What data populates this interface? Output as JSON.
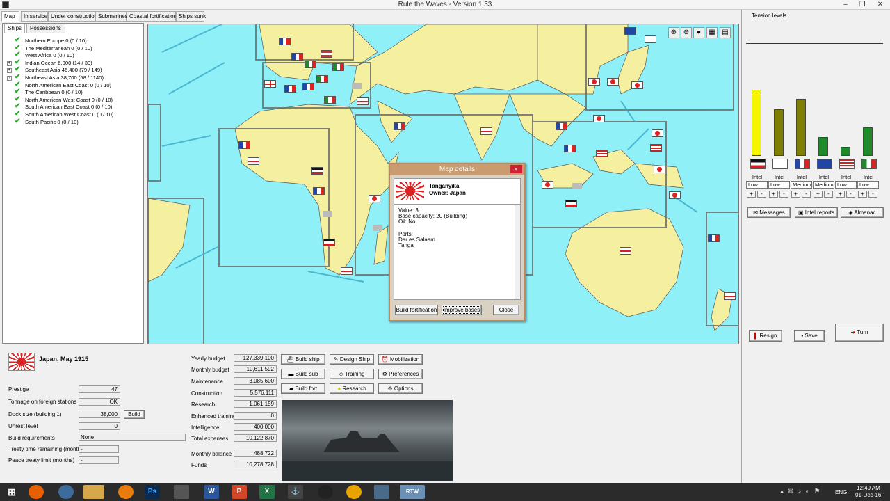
{
  "window": {
    "title": "Rule the Waves - Version 1.33",
    "minimize": "–",
    "restore": "❐",
    "close": "✕"
  },
  "tabs": [
    "Map",
    "In service",
    "Under construction",
    "Submarines",
    "Coastal fortifications",
    "Ships sunk"
  ],
  "subtabs": [
    "Ships",
    "Possessions"
  ],
  "regions": [
    {
      "label": "Northern Europe 0 (0 / 10)",
      "expandable": false
    },
    {
      "label": "The Mediterranean 0 (0 / 10)",
      "expandable": false
    },
    {
      "label": "West Africa 0 (0 / 10)",
      "expandable": false
    },
    {
      "label": "Indian Ocean 6,000 (14 / 30)",
      "expandable": true
    },
    {
      "label": "Southeast Asia 46,400 (79 / 149)",
      "expandable": true
    },
    {
      "label": "Northeast Asia 38,700 (58 / 1140)",
      "expandable": true
    },
    {
      "label": "North American East Coast 0 (0 / 10)",
      "expandable": false
    },
    {
      "label": "The Caribbean 0 (0 / 10)",
      "expandable": false
    },
    {
      "label": "North American West Coast 0 (0 / 10)",
      "expandable": false
    },
    {
      "label": "South American East Coast 0 (0 / 10)",
      "expandable": false
    },
    {
      "label": "South American West Coast 0 (0 / 10)",
      "expandable": false
    },
    {
      "label": "South Pacific 0 (0 / 10)",
      "expandable": false
    }
  ],
  "map_tools": [
    "zoom-in",
    "zoom-out",
    "oil",
    "toggle-a",
    "toggle-b"
  ],
  "dialog": {
    "title": "Map details",
    "close": "x",
    "name": "Tanganyika",
    "owner": "Owner: Japan",
    "value": "Value: 3",
    "base_capacity": "Base capacity: 20 (Building)",
    "oil": "Oil: No",
    "ports_header": "Ports:",
    "ports": [
      "Dar es Salaam",
      "Tanga"
    ],
    "buttons": {
      "build_fortification": "Build fortification",
      "improve_bases": "Improve bases",
      "close": "Close"
    }
  },
  "tension": {
    "title": "Tension levels",
    "levels": [
      0.95,
      0.67,
      0.82,
      0.27,
      0.13,
      0.41
    ],
    "bar_colors": [
      "#f5f500",
      "#7f7f00",
      "#7f7f00",
      "#1e8a2a",
      "#1e8a2a",
      "#1e8a2a"
    ],
    "nations": [
      "Germany",
      "Britain",
      "France",
      "Russia",
      "USA",
      "Italy"
    ],
    "intel_label": "Intel effort",
    "intel_values": [
      "Low",
      "Low",
      "Medium",
      "Medium",
      "Low",
      "Low"
    ],
    "plus": "+",
    "minus": "-",
    "buttons": {
      "messages": "Messages",
      "intel_reports": "Intel reports",
      "almanac": "Almanac"
    }
  },
  "game_buttons": {
    "resign": "Resign",
    "save": "Save",
    "turn": "Turn"
  },
  "nation": {
    "title": "Japan, May 1915",
    "prestige_label": "Prestige",
    "prestige": "47",
    "tonnage_label": "Tonnage on foreign stations",
    "tonnage": "OK",
    "dock_label": "Dock size (building 1)",
    "dock": "38,000",
    "build": "Build",
    "unrest_label": "Unrest level",
    "unrest": "0",
    "requirements_label": "Build requirements",
    "requirements": "None",
    "treaty_label": "Treaty time remaining (months)",
    "treaty": "-",
    "peace_label": "Peace treaty limit (months)",
    "peace": "-"
  },
  "budget": [
    {
      "label": "Yearly budget",
      "value": "127,339,100"
    },
    {
      "label": "Monthly budget",
      "value": "10,611,592"
    },
    {
      "label": "Maintenance",
      "value": "3,085,600"
    },
    {
      "label": "Construction",
      "value": "5,576,111"
    },
    {
      "label": "Research",
      "value": "1,061,159"
    },
    {
      "label": "Enhanced training",
      "value": "0"
    },
    {
      "label": "Intelligence",
      "value": "400,000"
    },
    {
      "label": "Total expenses",
      "value": "10,122,870"
    }
  ],
  "balance": [
    {
      "label": "Monthly balance",
      "value": "488,722"
    },
    {
      "label": "Funds",
      "value": "10,278,728"
    }
  ],
  "actions": {
    "build_ship": "Build ship",
    "design_ship": "Design Ship",
    "mobilization": "Mobilization",
    "build_sub": "Build sub",
    "training": "Training",
    "preferences": "Preferences",
    "build_fort": "Build fort",
    "research": "Research",
    "options": "Options"
  },
  "taskbar": {
    "time": "12:49 AM",
    "date": "01-Dec-16",
    "lang": "ENG",
    "rtw": "RTW"
  }
}
